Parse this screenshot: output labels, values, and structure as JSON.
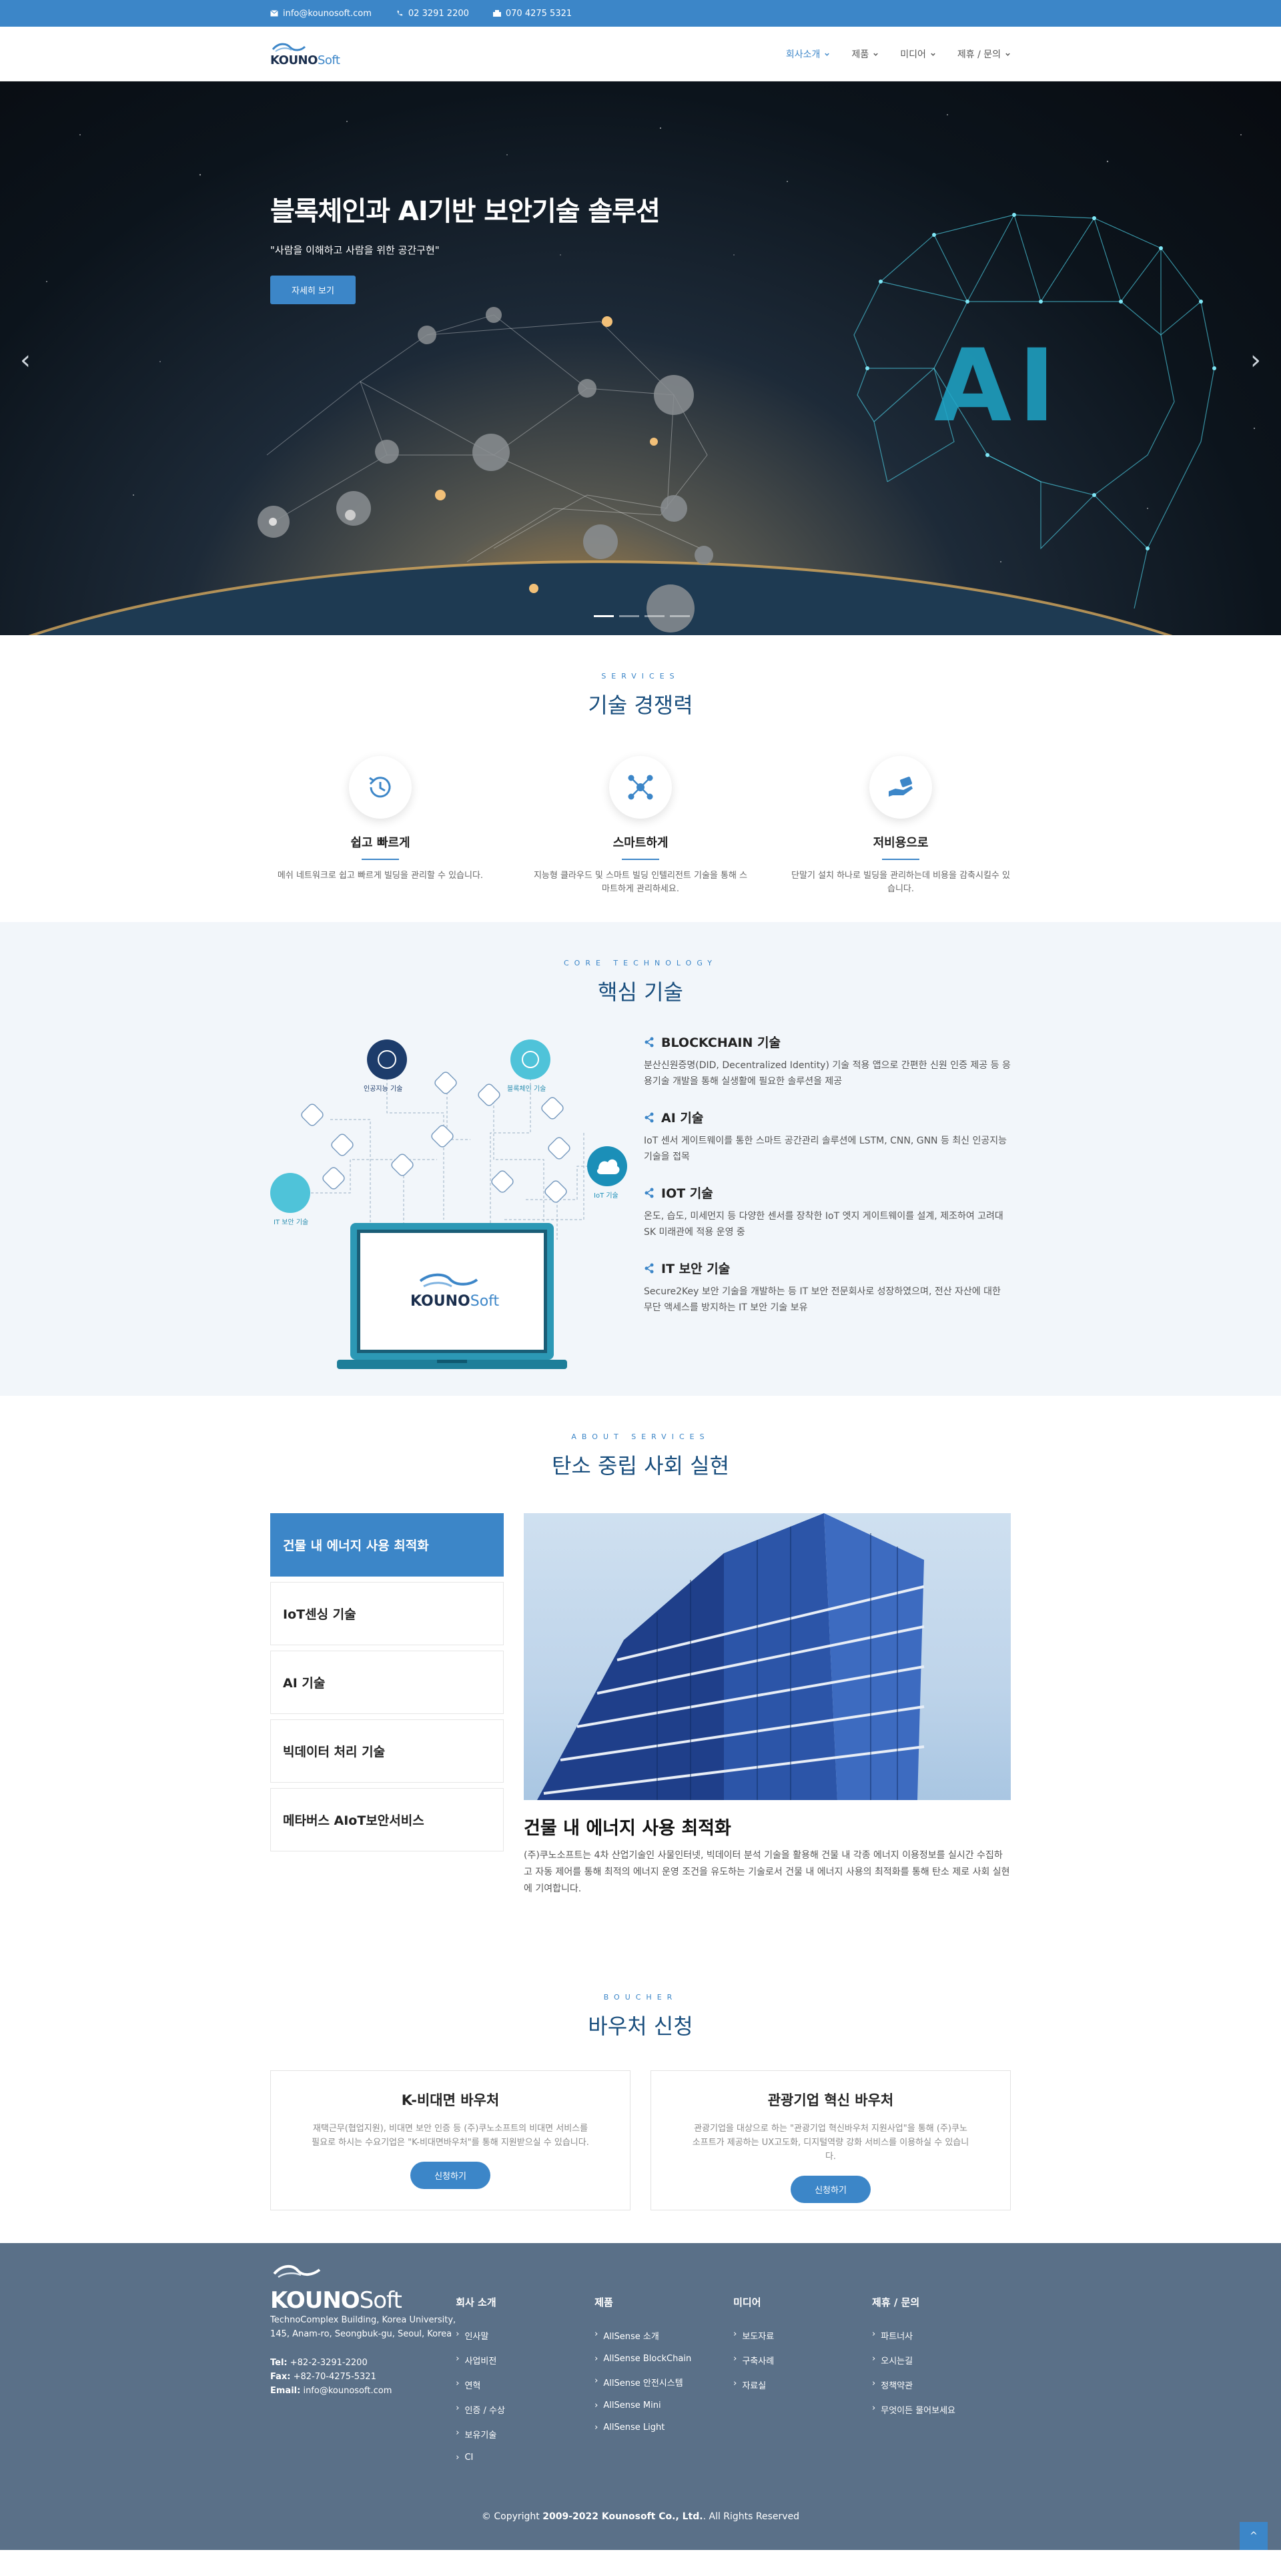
{
  "topbar": {
    "email": "info@kounosoft.com",
    "phone": "02 3291 2200",
    "mobile": "070 4275 5321"
  },
  "header": {
    "logo_main": "KOUNO",
    "logo_accent": "Soft",
    "nav": [
      "회사소개",
      "제품",
      "미디어",
      "제휴 / 문의"
    ]
  },
  "hero": {
    "title": "블록체인과 AI기반 보안기술 솔루션",
    "subtitle": "\"사람을 이해하고 사람을 위한 공간구현\"",
    "button": "자세히 보기",
    "ai_label": "AI",
    "prev": "‹",
    "next": "›"
  },
  "services": {
    "eyebrow": "SERVICES",
    "title": "기술 경쟁력",
    "items": [
      {
        "title": "쉽고 빠르게",
        "desc": "메쉬 네트워크로 쉽고 빠르게 빌딩을 관리할 수 있습니다.",
        "icon": "clock-history-icon"
      },
      {
        "title": "스마트하게",
        "desc": "지능형 클라우드 및 스마트 빌딩 인텔리전트 기술을 통해 스마트하게 관리하세요.",
        "icon": "network-hub-icon"
      },
      {
        "title": "저비용으로",
        "desc": "단말기 설치 하나로 빌딩을 관리하는데 비용을 감축시킬수 있습니다.",
        "icon": "hand-coin-icon"
      }
    ]
  },
  "core": {
    "eyebrow": "CORE TECHNOLOGY",
    "title": "핵심 기술",
    "illus": {
      "ai": "인공지능 기술",
      "blockchain": "블록체인 기술",
      "it": "IT 보안 기술",
      "iot": "IoT 기술",
      "logo_main": "KOUNO",
      "logo_accent": "Soft"
    },
    "items": [
      {
        "title": "BLOCKCHAIN 기술",
        "desc": "분산신원증명(DID, Decentralized Identity) 기술 적용 앱으로 간편한 신원 인증 제공 등 응용기술 개발을 통해 실생활에 필요한 솔루션을 제공"
      },
      {
        "title": "AI 기술",
        "desc": "IoT 센서 게이트웨이를 통한 스마트 공간관리 솔루션에 LSTM, CNN, GNN 등 최신 인공지능 기술을 접목"
      },
      {
        "title": "IOT 기술",
        "desc": "온도, 습도, 미세먼지 등 다양한 센서를 장착한 IoT 엣지 게이트웨이를 설계, 제조하여 고려대 SK 미래관에 적용 운영 중"
      },
      {
        "title": "IT 보안 기술",
        "desc": "Secure2Key 보안 기술을 개발하는 등 IT 보안 전문회사로 성장하였으며, 전산 자산에 대한 무단 액세스를 방지하는 IT 보안 기술 보유"
      }
    ]
  },
  "about": {
    "eyebrow": "ABOUT SERVICES",
    "title": "탄소 중립 사회 실현",
    "tabs": [
      "건물 내 에너지 사용 최적화",
      "IoT센싱 기술",
      "AI 기술",
      "빅데이터 처리 기술",
      "메타버스 AIoT보안서비스"
    ],
    "active_tab": 0,
    "content_title": "건물 내 에너지 사용 최적화",
    "content_desc": "(주)쿠노소프트는 4차 산업기술인 사물인터넷, 빅데이터 분석 기술을 활용해 건물 내 각종 에너지 이용정보를 실시간 수집하고 자동 제어를 통해 최적의 에너지 운영 조건을 유도하는 기술로서 건물 내 에너지 사용의 최적화를 통해 탄소 제로 사회 실현에 기여합니다."
  },
  "voucher": {
    "eyebrow": "BOUCHER",
    "title": "바우처 신청",
    "cards": [
      {
        "title": "K-비대면 바우처",
        "desc": "재택근무(협업지원), 비대면 보안 인증 등 (주)쿠노소프트의 비대면 서비스를 필요로 하시는 수요기업은 \"K-비대면바우처\"를 통해 지원받으실 수 있습니다.",
        "button": "신청하기"
      },
      {
        "title": "관광기업 혁신 바우처",
        "desc": "관광기업을 대상으로 하는 \"관광기업 혁신바우처 지원사업\"을 통해 (주)쿠노소프트가 제공하는 UX고도화, 디지털역량 강화 서비스를 이용하실 수 있습니다.",
        "button": "신청하기"
      }
    ]
  },
  "footer": {
    "logo_main": "KOUNO",
    "logo_accent": "Soft",
    "address": "TechnoComplex Building, Korea University, 145, Anam-ro, Seongbuk-gu, Seoul, Korea",
    "tel_label": "Tel:",
    "tel": "+82-2-3291-2200",
    "fax_label": "Fax:",
    "fax": "+82-70-4275-5321",
    "email_label": "Email:",
    "email": "info@kounosoft.com",
    "columns": [
      {
        "title": "회사 소개",
        "links": [
          "인사말",
          "사업비전",
          "연혁",
          "인증 / 수상",
          "보유기술",
          "CI"
        ]
      },
      {
        "title": "제품",
        "links": [
          "AllSense 소개",
          "AllSense BlockChain",
          "AllSense 안전시스템",
          "AllSense Mini",
          "AllSense Light"
        ]
      },
      {
        "title": "미디어",
        "links": [
          "보도자료",
          "구축사례",
          "자료실"
        ]
      },
      {
        "title": "제휴 / 문의",
        "links": [
          "파트너사",
          "오시는길",
          "정책약관",
          "무엇이든 물어보세요"
        ]
      }
    ],
    "copyright_prefix": "© Copyright",
    "copyright_bold": "2009-2022 Kounosoft Co., Ltd.",
    "copyright_suffix": ". All Rights Reserved",
    "to_top": "^"
  },
  "colors": {
    "brand": "#3c86c8",
    "navy": "#1a4f7e",
    "footer": "#5a7088"
  }
}
